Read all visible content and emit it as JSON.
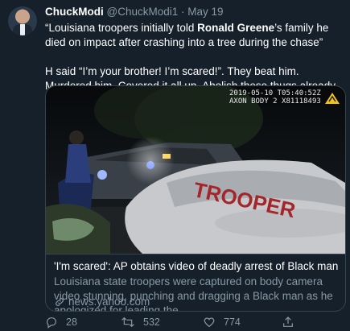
{
  "tweet": {
    "author_name": "ChuckModi",
    "author_handle": "@ChuckModi1",
    "separator": "·",
    "date": "May 19",
    "line1_before": "“Louisiana troopers initially told ",
    "line1_bold": "Ronald Greene",
    "line1_after": "’s family he died on impact after crashing into a tree during the chase”",
    "line2": "H said “I’m your brother! I’m scared!”. They beat him. Murdered him. Covered it all up. Abolish these thugs already."
  },
  "card": {
    "camera_timestamp": "2019-05-10 T05:40:52Z",
    "camera_id": "AXON BODY 2 X81118493",
    "car_text": "TROOPER",
    "title": "'I'm scared': AP obtains video of deadly arrest of Black man",
    "description": "Louisiana state troopers were captured on body camera video stunning, punching and dragging a Black man as he apologized for leading the...",
    "source": "news.yahoo.com"
  },
  "actions": {
    "replies": "28",
    "retweets": "532",
    "likes": "774"
  },
  "colors": {
    "background": "#15202b",
    "secondary_text": "#8899a6",
    "border": "#38444d"
  }
}
